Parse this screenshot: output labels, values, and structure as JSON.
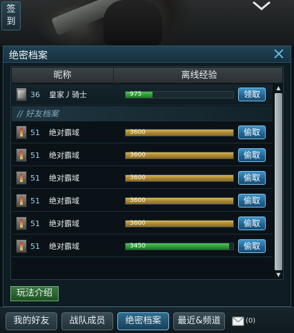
{
  "signin": {
    "label": "签\n到"
  },
  "panel": {
    "title": "绝密档案",
    "close": "×",
    "columns": {
      "nickname": "昵称",
      "offline_exp": "离线经验"
    }
  },
  "self_row": {
    "level": "36",
    "name": "皇家丿骑士",
    "exp": "975",
    "exp_fill": 0.25,
    "exp_color": "#2e9a37",
    "button": "领取"
  },
  "friends_section": {
    "title": "//  好友档案"
  },
  "friends": [
    {
      "level": "51",
      "name": "绝对霸域",
      "exp": "3600",
      "exp_fill": 1.0,
      "bar": "gold",
      "button": "偷取"
    },
    {
      "level": "51",
      "name": "绝对霸域",
      "exp": "3600",
      "exp_fill": 1.0,
      "bar": "gold",
      "button": "偷取"
    },
    {
      "level": "51",
      "name": "绝对霸域",
      "exp": "3600",
      "exp_fill": 1.0,
      "bar": "gold",
      "button": "偷取"
    },
    {
      "level": "51",
      "name": "绝对霸域",
      "exp": "3600",
      "exp_fill": 1.0,
      "bar": "gold",
      "button": "偷取"
    },
    {
      "level": "51",
      "name": "绝对霸域",
      "exp": "3600",
      "exp_fill": 1.0,
      "bar": "gold",
      "button": "偷取"
    },
    {
      "level": "51",
      "name": "绝对霸域",
      "exp": "3450",
      "exp_fill": 0.96,
      "bar": "green",
      "button": "偷取"
    }
  ],
  "rules_button": "玩法介绍",
  "tabs": [
    {
      "label": "我的好友",
      "active": false
    },
    {
      "label": "战队成员",
      "active": false
    },
    {
      "label": "绝密档案",
      "active": true
    },
    {
      "label": "最近&频道",
      "active": false
    }
  ],
  "mail": {
    "count": "(0)",
    "icon": "envelope-icon"
  },
  "colors": {
    "accent": "#2d6b8f",
    "gold_bar": "#a88432",
    "green_bar": "#2e9a37",
    "button_blue": "#1f6393"
  }
}
